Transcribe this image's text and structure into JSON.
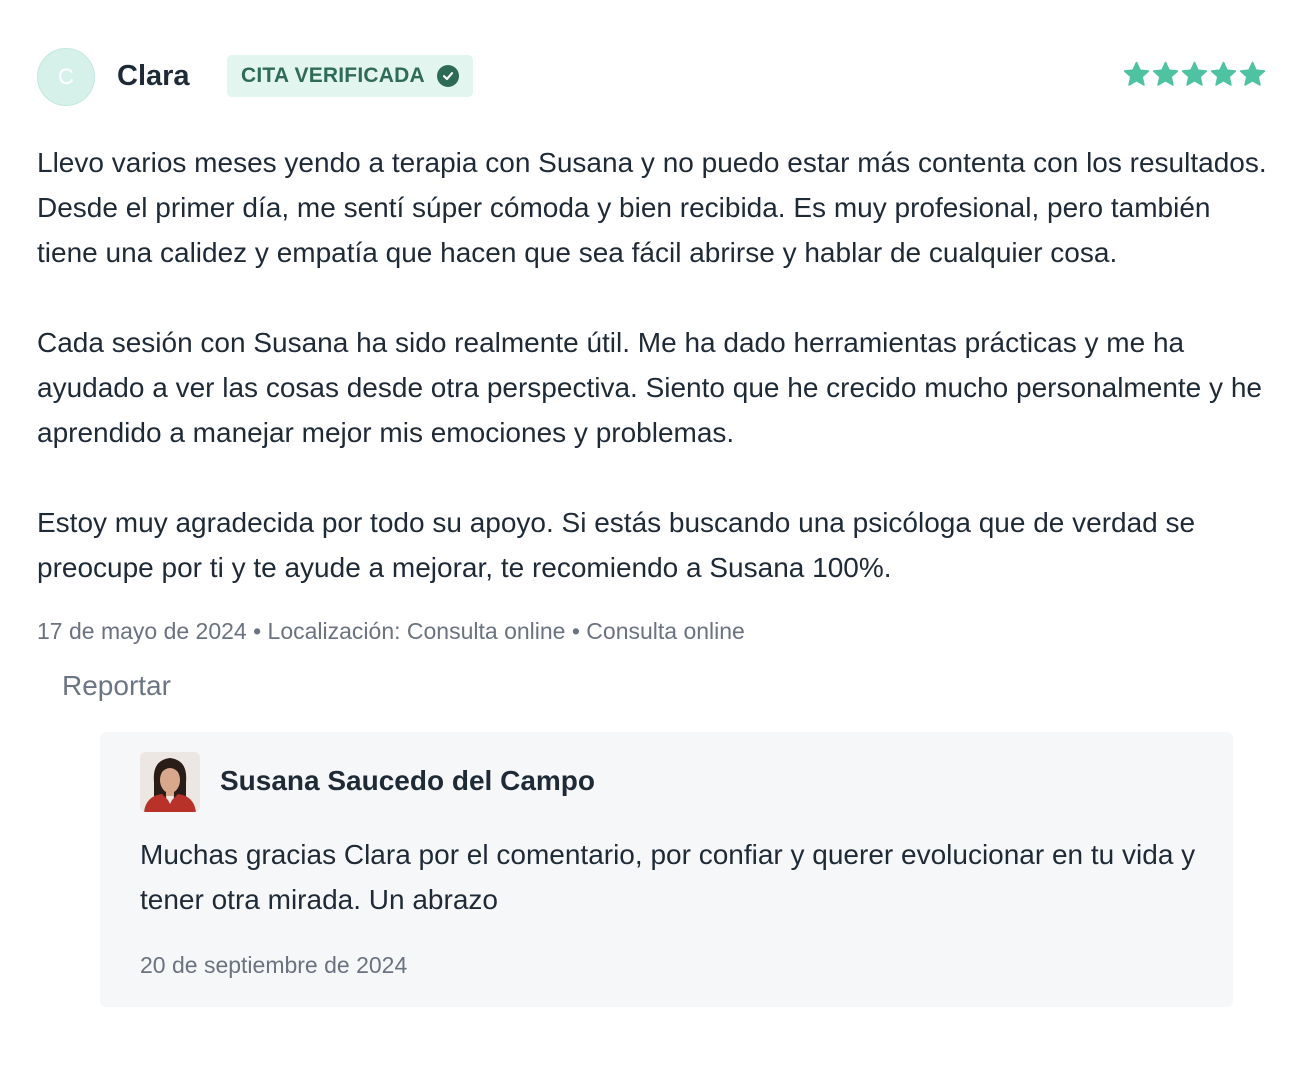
{
  "review": {
    "avatar_initial": "C",
    "author": "Clara",
    "badge_label": "CITA VERIFICADA",
    "rating": 5,
    "rating_max": 5,
    "paragraphs": [
      "Llevo varios meses yendo a terapia con Susana y no puedo estar más contenta con los resultados. Desde el primer día, me sentí súper cómoda y bien recibida. Es muy profesional, pero también tiene una calidez y empatía que hacen que sea fácil abrirse y hablar de cualquier cosa.",
      "Cada sesión con Susana ha sido realmente útil. Me ha dado herramientas prácticas y me ha ayudado a ver las cosas desde otra perspectiva. Siento que he crecido mucho personalmente y he aprendido a manejar mejor mis emociones y problemas.",
      "Estoy muy agradecida por todo su apoyo. Si estás buscando una psicóloga que de verdad se preocupe por ti y te ayude a mejorar, te recomiendo a Susana 100%."
    ],
    "meta": "17 de mayo de 2024 • Localización: Consulta online • Consulta online",
    "report_label": "Reportar"
  },
  "reply": {
    "author": "Susana Saucedo del Campo",
    "text": "Muchas gracias Clara por el comentario, por confiar y querer evolucionar en tu vida y tener otra mirada. Un abrazo",
    "date": "20 de septiembre de 2024"
  },
  "colors": {
    "star": "#4fc3a1",
    "badge_bg": "#e2f5ef",
    "badge_text": "#2f6b58",
    "avatar_bg": "#d6f1ea",
    "reply_bg": "#f6f7f9"
  },
  "icons": {
    "verified": "check-circle-icon",
    "rating": "star-icon"
  }
}
